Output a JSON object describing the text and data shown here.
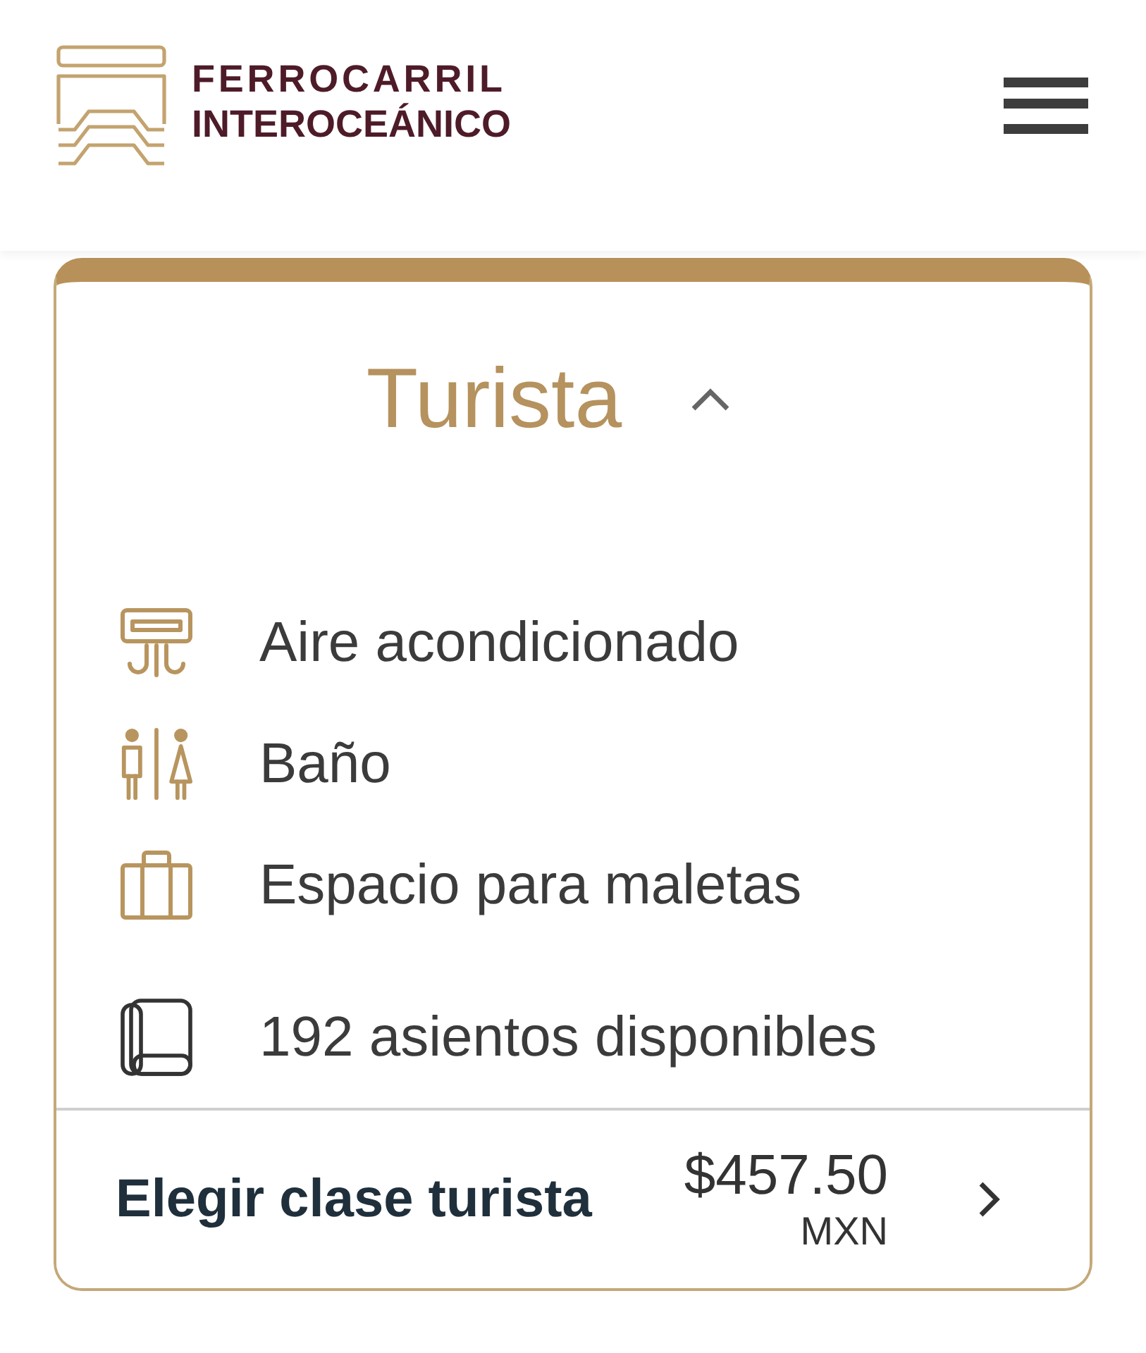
{
  "header": {
    "brand_lines": [
      "FERROCARRIL",
      "INTEROCEÁNICO"
    ]
  },
  "fare_card": {
    "title": "Turista",
    "expanded": true,
    "amenities": [
      {
        "kind": "air_conditioning",
        "label": "Aire acondicionado"
      },
      {
        "kind": "restroom",
        "label": "Baño"
      },
      {
        "kind": "luggage",
        "label": "Espacio para maletas"
      },
      {
        "kind": "seat",
        "label": "192 asientos disponibles"
      }
    ],
    "action": {
      "label": "Elegir clase turista",
      "price": "$457.50",
      "currency": "MXN"
    }
  }
}
